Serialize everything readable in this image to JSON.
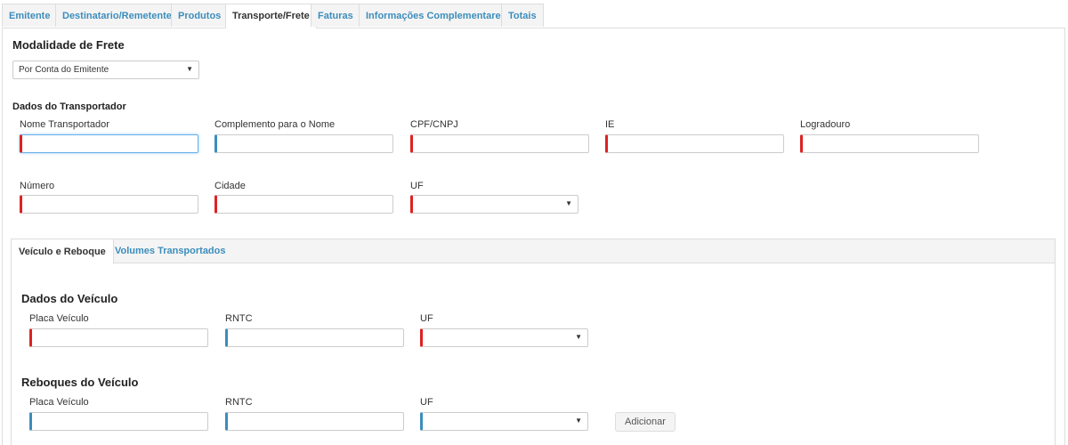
{
  "tabs": [
    "Emitente",
    "Destinatario/Remetente",
    "Produtos",
    "Transporte/Frete",
    "Faturas",
    "Informações Complementares",
    "Totais"
  ],
  "active_tab": "Transporte/Frete",
  "frete": {
    "title": "Modalidade de Frete",
    "selected": "Por Conta do Emitente"
  },
  "transportador": {
    "title": "Dados do Transportador",
    "nome_label": "Nome Transportador",
    "complemento_label": "Complemento para o Nome",
    "cpf_label": "CPF/CNPJ",
    "ie_label": "IE",
    "logradouro_label": "Logradouro",
    "numero_label": "Número",
    "cidade_label": "Cidade",
    "uf_label": "UF"
  },
  "subtabs": [
    "Veículo e Reboque",
    "Volumes Transportados"
  ],
  "veiculo": {
    "title": "Dados do Veículo",
    "placa_label": "Placa Veículo",
    "rntc_label": "RNTC",
    "uf_label": "UF"
  },
  "reboque": {
    "title": "Reboques do Veículo",
    "placa_label": "Placa Veículo",
    "rntc_label": "RNTC",
    "uf_label": "UF",
    "add_button": "Adicionar"
  },
  "colors": {
    "required": "#dd2222",
    "optional": "#3c8dbc",
    "link": "#3c8dbc"
  },
  "icons": {
    "select_caret": "caret-down-icon"
  }
}
